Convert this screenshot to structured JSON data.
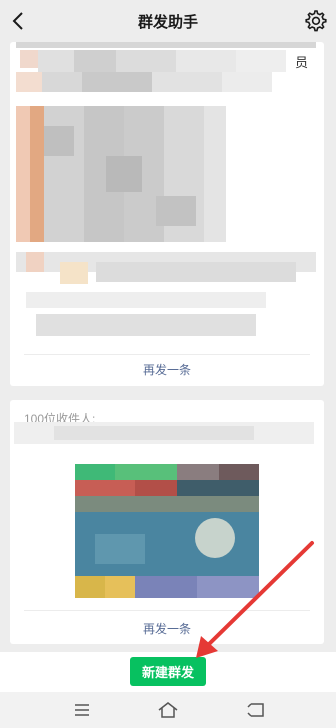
{
  "header": {
    "title": "群发助手",
    "back_icon": "chevron-left-icon",
    "settings_icon": "gear-icon"
  },
  "messages": [
    {
      "top_text_fragment": "员",
      "action_label": "再发一条"
    },
    {
      "recipients_label": "100位收件人:",
      "action_label": "再发一条"
    }
  ],
  "footer": {
    "new_button_label": "新建群发",
    "button_color": "#07c160"
  },
  "system_nav": {
    "icons": [
      "menu-icon",
      "home-icon",
      "back-icon"
    ]
  },
  "annotation": {
    "arrow_color": "#e53935",
    "arrow_icon": "red-arrow-annotation"
  }
}
